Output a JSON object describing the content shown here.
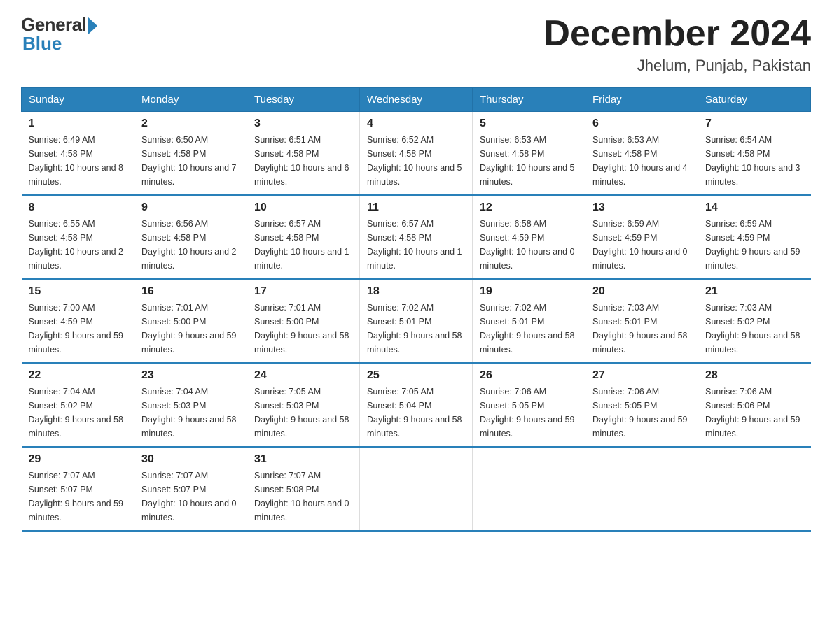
{
  "logo": {
    "general": "General",
    "blue": "Blue"
  },
  "header": {
    "month": "December 2024",
    "location": "Jhelum, Punjab, Pakistan"
  },
  "days_of_week": [
    "Sunday",
    "Monday",
    "Tuesday",
    "Wednesday",
    "Thursday",
    "Friday",
    "Saturday"
  ],
  "weeks": [
    [
      {
        "day": "1",
        "sunrise": "6:49 AM",
        "sunset": "4:58 PM",
        "daylight": "10 hours and 8 minutes."
      },
      {
        "day": "2",
        "sunrise": "6:50 AM",
        "sunset": "4:58 PM",
        "daylight": "10 hours and 7 minutes."
      },
      {
        "day": "3",
        "sunrise": "6:51 AM",
        "sunset": "4:58 PM",
        "daylight": "10 hours and 6 minutes."
      },
      {
        "day": "4",
        "sunrise": "6:52 AM",
        "sunset": "4:58 PM",
        "daylight": "10 hours and 5 minutes."
      },
      {
        "day": "5",
        "sunrise": "6:53 AM",
        "sunset": "4:58 PM",
        "daylight": "10 hours and 5 minutes."
      },
      {
        "day": "6",
        "sunrise": "6:53 AM",
        "sunset": "4:58 PM",
        "daylight": "10 hours and 4 minutes."
      },
      {
        "day": "7",
        "sunrise": "6:54 AM",
        "sunset": "4:58 PM",
        "daylight": "10 hours and 3 minutes."
      }
    ],
    [
      {
        "day": "8",
        "sunrise": "6:55 AM",
        "sunset": "4:58 PM",
        "daylight": "10 hours and 2 minutes."
      },
      {
        "day": "9",
        "sunrise": "6:56 AM",
        "sunset": "4:58 PM",
        "daylight": "10 hours and 2 minutes."
      },
      {
        "day": "10",
        "sunrise": "6:57 AM",
        "sunset": "4:58 PM",
        "daylight": "10 hours and 1 minute."
      },
      {
        "day": "11",
        "sunrise": "6:57 AM",
        "sunset": "4:58 PM",
        "daylight": "10 hours and 1 minute."
      },
      {
        "day": "12",
        "sunrise": "6:58 AM",
        "sunset": "4:59 PM",
        "daylight": "10 hours and 0 minutes."
      },
      {
        "day": "13",
        "sunrise": "6:59 AM",
        "sunset": "4:59 PM",
        "daylight": "10 hours and 0 minutes."
      },
      {
        "day": "14",
        "sunrise": "6:59 AM",
        "sunset": "4:59 PM",
        "daylight": "9 hours and 59 minutes."
      }
    ],
    [
      {
        "day": "15",
        "sunrise": "7:00 AM",
        "sunset": "4:59 PM",
        "daylight": "9 hours and 59 minutes."
      },
      {
        "day": "16",
        "sunrise": "7:01 AM",
        "sunset": "5:00 PM",
        "daylight": "9 hours and 59 minutes."
      },
      {
        "day": "17",
        "sunrise": "7:01 AM",
        "sunset": "5:00 PM",
        "daylight": "9 hours and 58 minutes."
      },
      {
        "day": "18",
        "sunrise": "7:02 AM",
        "sunset": "5:01 PM",
        "daylight": "9 hours and 58 minutes."
      },
      {
        "day": "19",
        "sunrise": "7:02 AM",
        "sunset": "5:01 PM",
        "daylight": "9 hours and 58 minutes."
      },
      {
        "day": "20",
        "sunrise": "7:03 AM",
        "sunset": "5:01 PM",
        "daylight": "9 hours and 58 minutes."
      },
      {
        "day": "21",
        "sunrise": "7:03 AM",
        "sunset": "5:02 PM",
        "daylight": "9 hours and 58 minutes."
      }
    ],
    [
      {
        "day": "22",
        "sunrise": "7:04 AM",
        "sunset": "5:02 PM",
        "daylight": "9 hours and 58 minutes."
      },
      {
        "day": "23",
        "sunrise": "7:04 AM",
        "sunset": "5:03 PM",
        "daylight": "9 hours and 58 minutes."
      },
      {
        "day": "24",
        "sunrise": "7:05 AM",
        "sunset": "5:03 PM",
        "daylight": "9 hours and 58 minutes."
      },
      {
        "day": "25",
        "sunrise": "7:05 AM",
        "sunset": "5:04 PM",
        "daylight": "9 hours and 58 minutes."
      },
      {
        "day": "26",
        "sunrise": "7:06 AM",
        "sunset": "5:05 PM",
        "daylight": "9 hours and 59 minutes."
      },
      {
        "day": "27",
        "sunrise": "7:06 AM",
        "sunset": "5:05 PM",
        "daylight": "9 hours and 59 minutes."
      },
      {
        "day": "28",
        "sunrise": "7:06 AM",
        "sunset": "5:06 PM",
        "daylight": "9 hours and 59 minutes."
      }
    ],
    [
      {
        "day": "29",
        "sunrise": "7:07 AM",
        "sunset": "5:07 PM",
        "daylight": "9 hours and 59 minutes."
      },
      {
        "day": "30",
        "sunrise": "7:07 AM",
        "sunset": "5:07 PM",
        "daylight": "10 hours and 0 minutes."
      },
      {
        "day": "31",
        "sunrise": "7:07 AM",
        "sunset": "5:08 PM",
        "daylight": "10 hours and 0 minutes."
      },
      null,
      null,
      null,
      null
    ]
  ],
  "labels": {
    "sunrise": "Sunrise:",
    "sunset": "Sunset:",
    "daylight": "Daylight:"
  }
}
